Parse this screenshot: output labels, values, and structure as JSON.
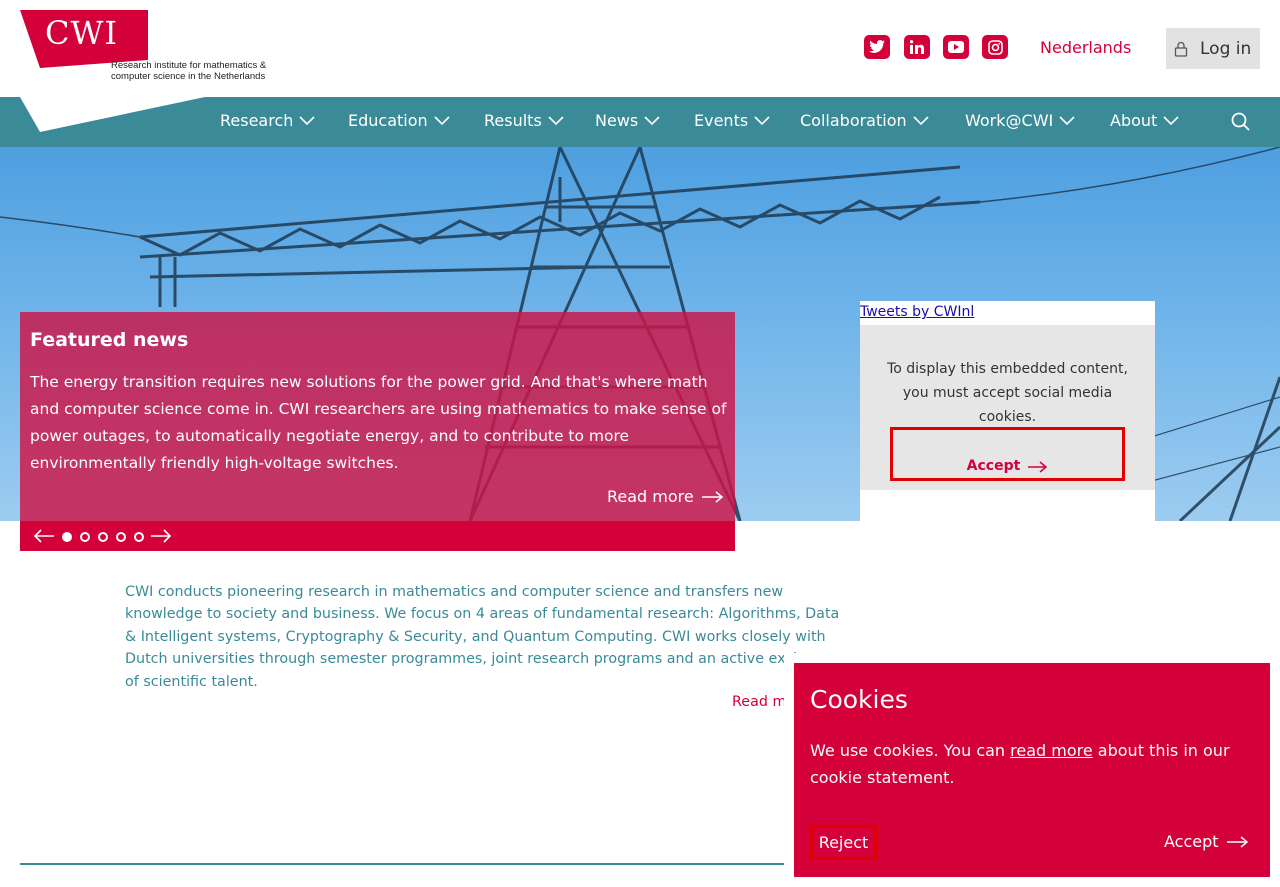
{
  "colors": {
    "brand_red": "#d3003a",
    "nav_teal": "#3a8a98",
    "sky_blue": "#6fb4ea"
  },
  "header": {
    "logo_text": "CWI",
    "logo_subtitle": "Research institute for mathematics & computer science in the Netherlands",
    "social_icons": [
      "twitter-icon",
      "linkedin-icon",
      "youtube-icon",
      "instagram-icon"
    ],
    "language_link": "Nederlands",
    "login_label": "Log in"
  },
  "nav": {
    "items": [
      {
        "label": "Research"
      },
      {
        "label": "Education"
      },
      {
        "label": "Results"
      },
      {
        "label": "News"
      },
      {
        "label": "Events"
      },
      {
        "label": "Collaboration"
      },
      {
        "label": "Work@CWI"
      },
      {
        "label": "About"
      }
    ],
    "search_icon": "search-icon"
  },
  "featured": {
    "heading": "Featured news",
    "body": "The energy transition requires new solutions for the power grid. And that's where math and computer science come in. CWI researchers are using mathematics to make sense of power outages, to automatically negotiate energy, and to contribute to more environmentally friendly high-voltage switches.",
    "read_more": "Read more",
    "slide_count": 5,
    "active_slide": 1
  },
  "tweets": {
    "link_text": "Tweets by CWInl",
    "consent_text": "To display this embedded content, you must accept social media cookies.",
    "accept_label": "Accept"
  },
  "intro": {
    "text": "CWI conducts pioneering research in mathematics and computer science and transfers new knowledge to society and business. We focus on 4 areas of fundamental research: Algorithms, Data & Intelligent systems, Cryptography & Security, and Quantum Computing. CWI works closely with Dutch universities through semester programmes, joint research programs and an active exchange of scientific talent.",
    "read_more": "Read more"
  },
  "cookie": {
    "title": "Cookies",
    "text_before": "We use cookies. You can ",
    "link_text": "read more",
    "text_after": " about this in our cookie statement.",
    "reject_label": "Reject",
    "accept_label": "Accept"
  }
}
